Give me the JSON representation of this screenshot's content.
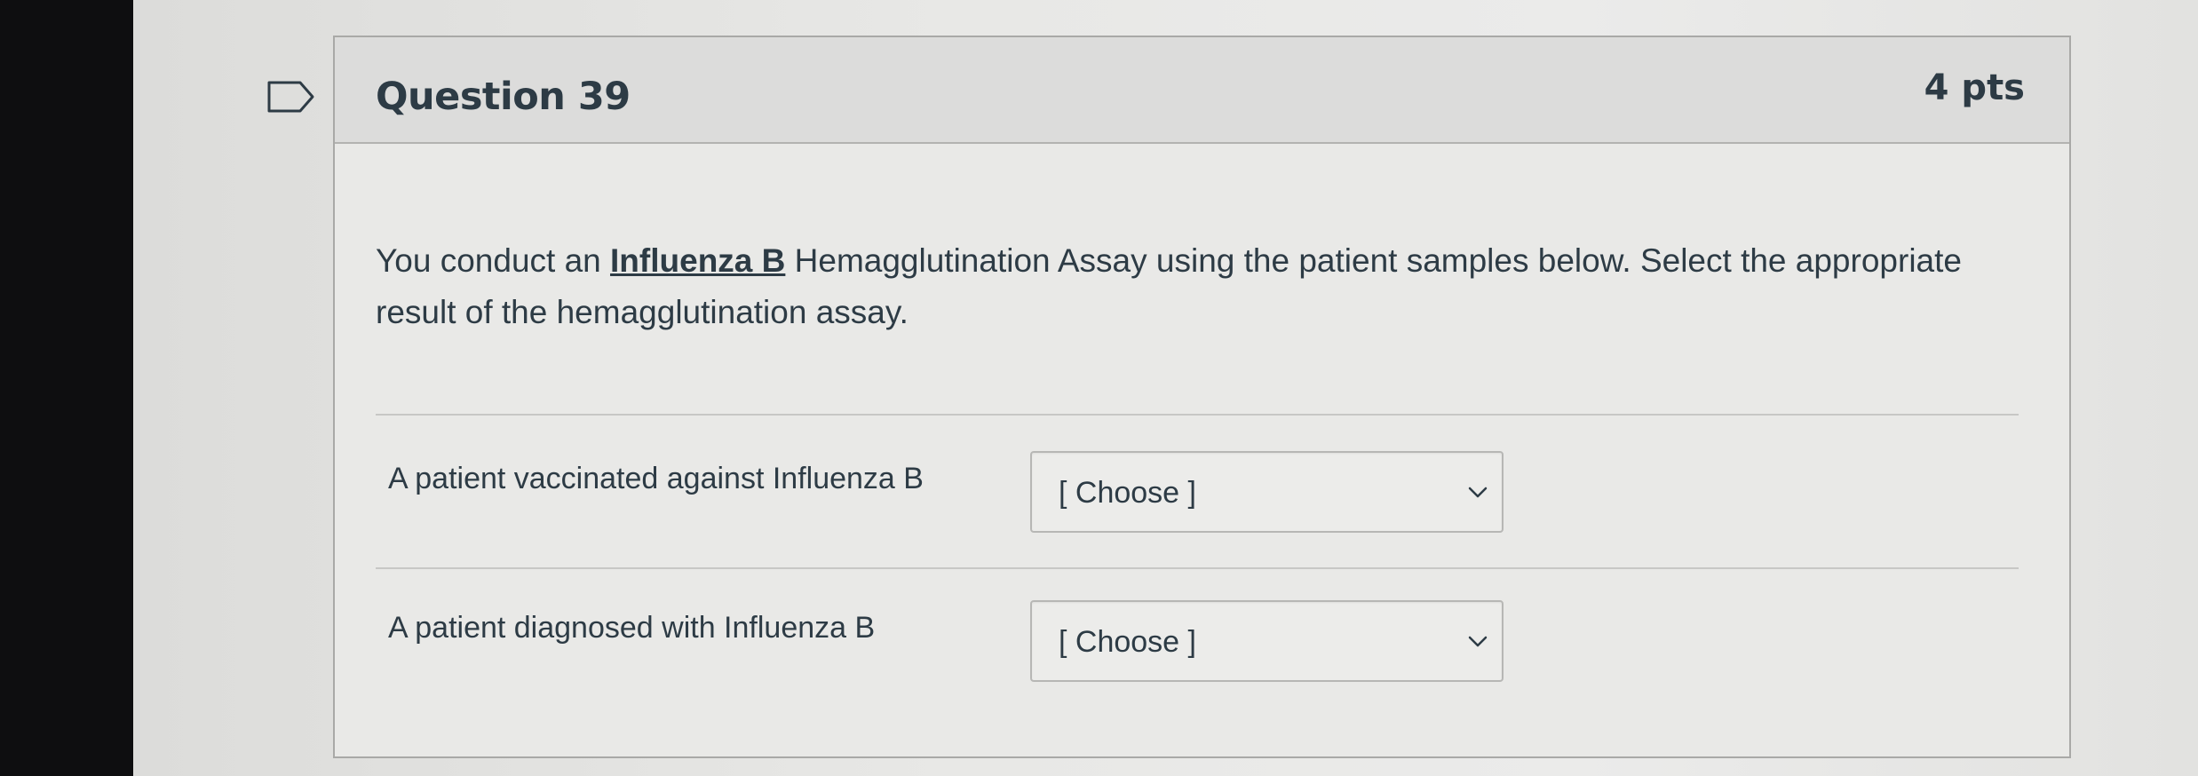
{
  "question": {
    "title": "Question 39",
    "points": "4 pts",
    "text_before": "You conduct an ",
    "text_emphasis": "Influenza B",
    "text_after": " Hemagglutination Assay using the patient samples below. Select the appropriate result of the hemagglutination assay."
  },
  "answers": [
    {
      "label": "A patient vaccinated against Influenza B",
      "selected": "[ Choose ]"
    },
    {
      "label": "A patient diagnosed with Influenza B",
      "selected": "[ Choose ]"
    }
  ],
  "icons": {
    "flag": "flag-question-icon",
    "dropdown": "chevron-down-icon"
  },
  "colors": {
    "text": "#2d3b45",
    "border": "#a9a9a7",
    "header_bg": "#dcdcdb"
  }
}
